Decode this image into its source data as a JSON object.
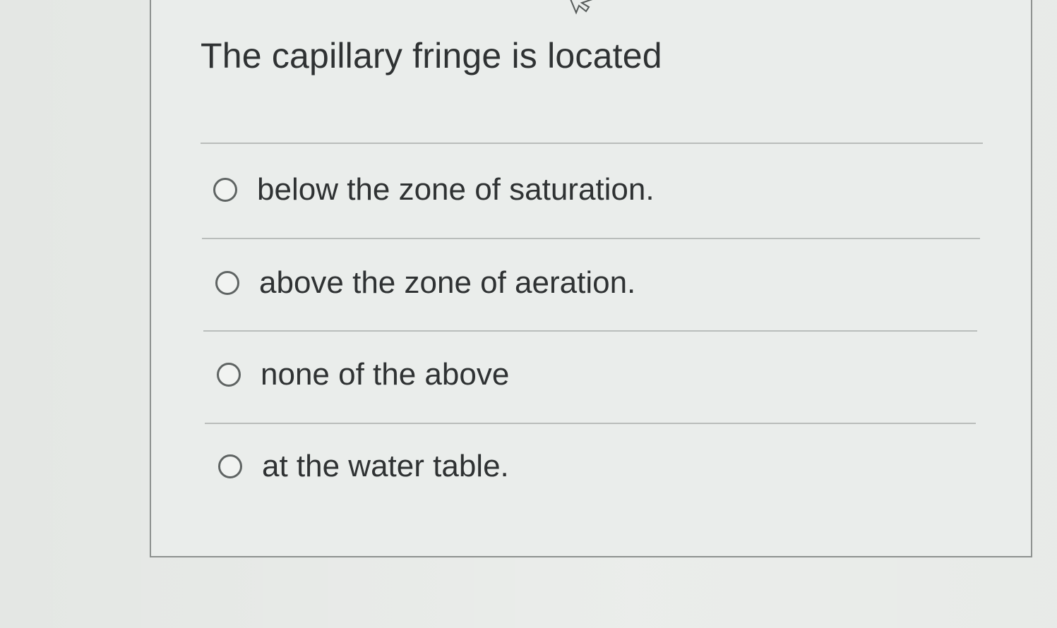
{
  "question": {
    "prompt": "The capillary fringe is located"
  },
  "options": [
    {
      "label": "below the zone of saturation.",
      "selected": false
    },
    {
      "label": "above the zone of aeration.",
      "selected": false
    },
    {
      "label": "none of the above",
      "selected": false
    },
    {
      "label": "at the water table.",
      "selected": false
    }
  ],
  "icons": {
    "cursor": "pointer-cursor-icon"
  }
}
